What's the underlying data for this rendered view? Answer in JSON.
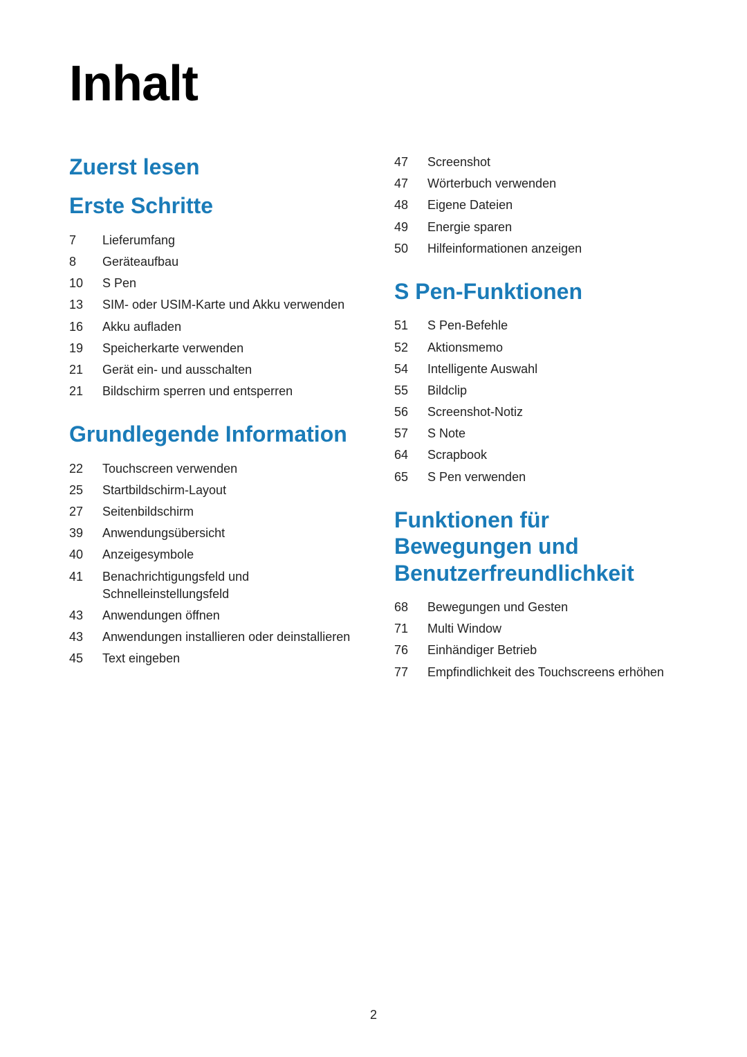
{
  "page": {
    "title": "Inhalt",
    "page_number": "2"
  },
  "sections": {
    "left": [
      {
        "heading": "Zuerst lesen",
        "items": []
      },
      {
        "heading": "Erste Schritte",
        "items": [
          {
            "number": "7",
            "label": "Lieferumfang"
          },
          {
            "number": "8",
            "label": "Geräteaufbau"
          },
          {
            "number": "10",
            "label": "S Pen"
          },
          {
            "number": "13",
            "label": "SIM- oder USIM-Karte und Akku verwenden"
          },
          {
            "number": "16",
            "label": "Akku aufladen"
          },
          {
            "number": "19",
            "label": "Speicherkarte verwenden"
          },
          {
            "number": "21",
            "label": "Gerät ein- und ausschalten"
          },
          {
            "number": "21",
            "label": "Bildschirm sperren und entsperren"
          }
        ]
      },
      {
        "heading": "Grundlegende Information",
        "items": [
          {
            "number": "22",
            "label": "Touchscreen verwenden"
          },
          {
            "number": "25",
            "label": "Startbildschirm-Layout"
          },
          {
            "number": "27",
            "label": "Seitenbildschirm"
          },
          {
            "number": "39",
            "label": "Anwendungsübersicht"
          },
          {
            "number": "40",
            "label": "Anzeigesymbole"
          },
          {
            "number": "41",
            "label": "Benachrichtigungsfeld und Schnelleinstellungsfeld"
          },
          {
            "number": "43",
            "label": "Anwendungen öffnen"
          },
          {
            "number": "43",
            "label": "Anwendungen installieren oder deinstallieren"
          },
          {
            "number": "45",
            "label": "Text eingeben"
          }
        ]
      }
    ],
    "right": [
      {
        "heading": "",
        "items": [
          {
            "number": "47",
            "label": "Screenshot"
          },
          {
            "number": "47",
            "label": "Wörterbuch verwenden"
          },
          {
            "number": "48",
            "label": "Eigene Dateien"
          },
          {
            "number": "49",
            "label": "Energie sparen"
          },
          {
            "number": "50",
            "label": "Hilfeinformationen anzeigen"
          }
        ]
      },
      {
        "heading": "S Pen-Funktionen",
        "items": [
          {
            "number": "51",
            "label": "S Pen-Befehle"
          },
          {
            "number": "52",
            "label": "Aktionsmemo"
          },
          {
            "number": "54",
            "label": "Intelligente Auswahl"
          },
          {
            "number": "55",
            "label": "Bildclip"
          },
          {
            "number": "56",
            "label": "Screenshot-Notiz"
          },
          {
            "number": "57",
            "label": "S Note"
          },
          {
            "number": "64",
            "label": "Scrapbook"
          },
          {
            "number": "65",
            "label": "S Pen verwenden"
          }
        ]
      },
      {
        "heading": "Funktionen für Bewegungen und Benutzerfreundlichkeit",
        "items": [
          {
            "number": "68",
            "label": "Bewegungen und Gesten"
          },
          {
            "number": "71",
            "label": "Multi Window"
          },
          {
            "number": "76",
            "label": "Einhändiger Betrieb"
          },
          {
            "number": "77",
            "label": "Empfindlichkeit des Touchscreens erhöhen"
          }
        ]
      }
    ]
  }
}
